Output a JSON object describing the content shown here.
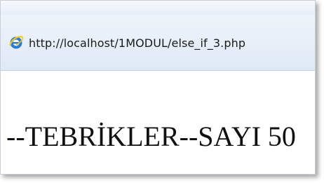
{
  "browser": {
    "address": {
      "icon": "internet-explorer-icon",
      "url": "http://localhost/1MODUL/else_if_3.php"
    }
  },
  "page": {
    "message": "--TEBRİKLER--SAYI 50"
  }
}
